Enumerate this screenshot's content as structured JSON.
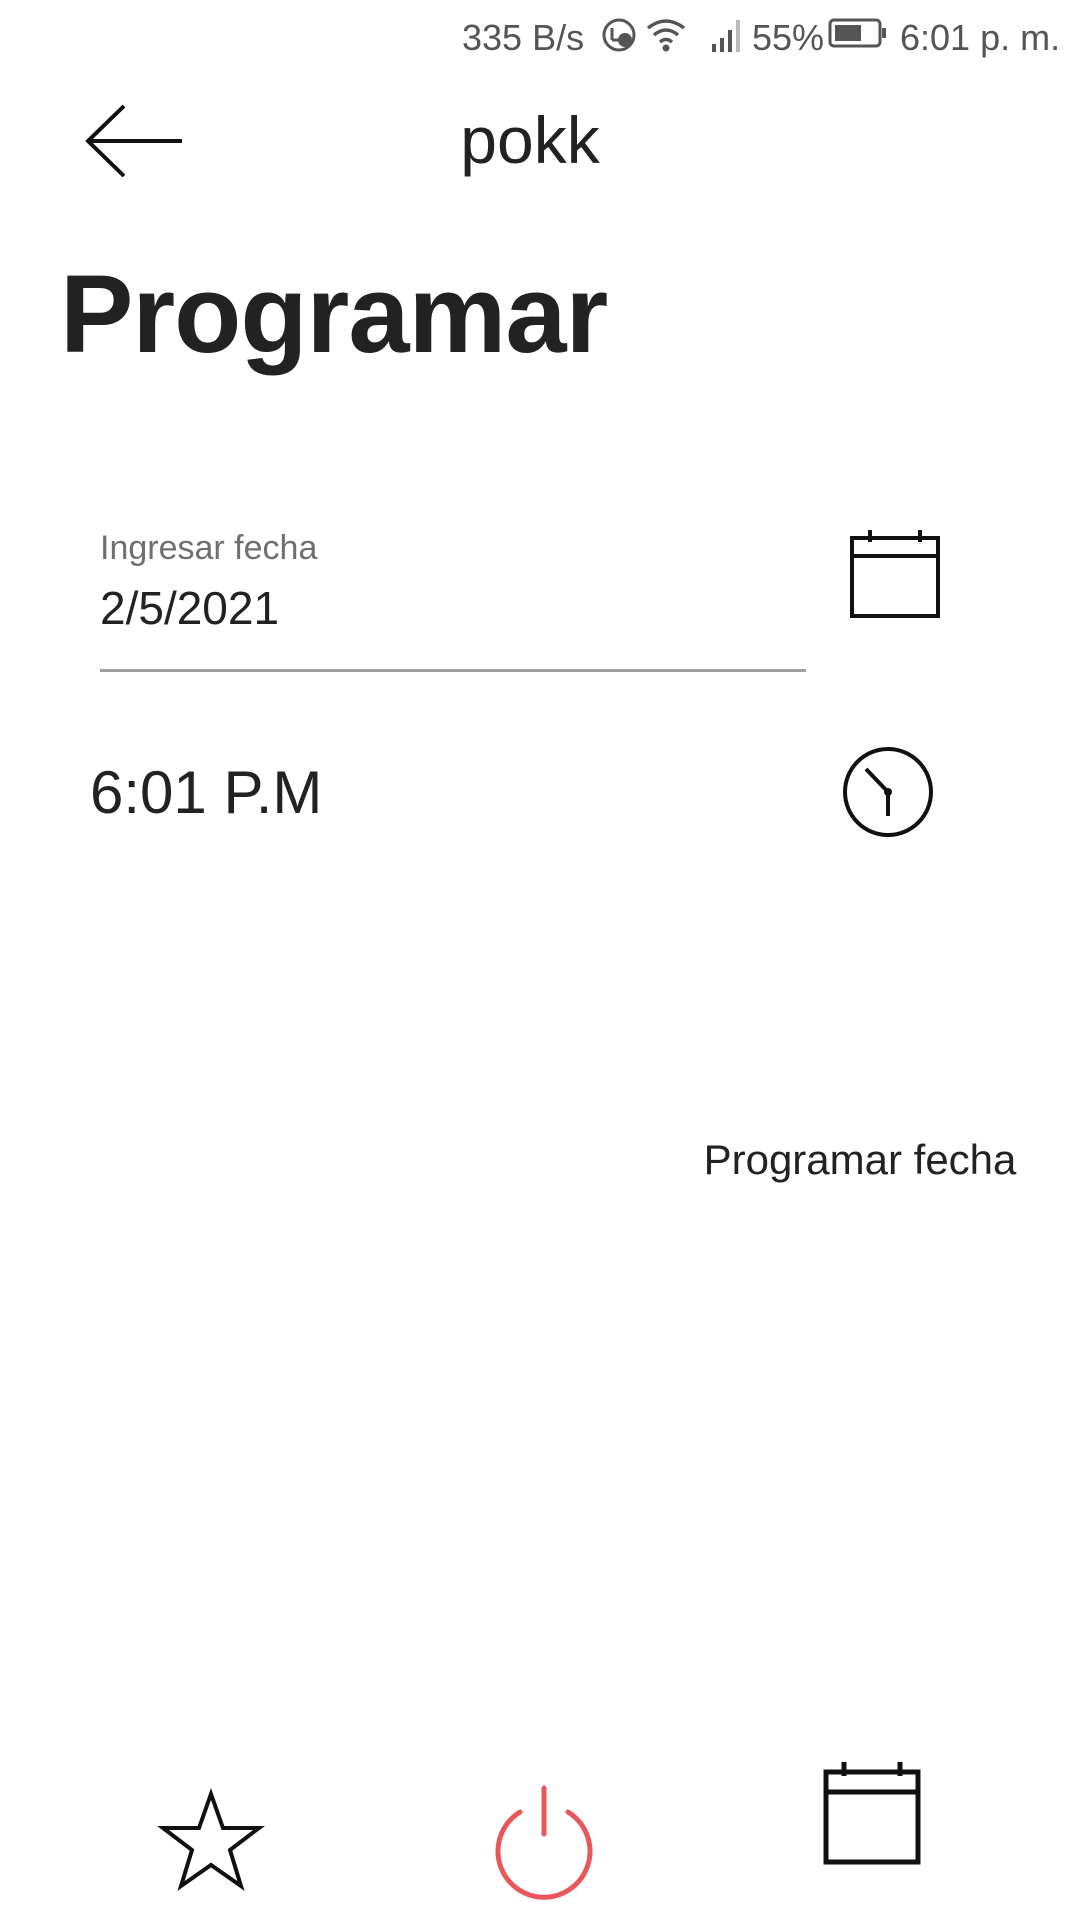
{
  "status_bar": {
    "network_speed": "335 B/s",
    "battery": "55%",
    "time": "6:01 p. m."
  },
  "app_bar": {
    "title": "pokk",
    "back_icon": "arrow-left-icon"
  },
  "page": {
    "title": "Programar"
  },
  "date_field": {
    "label": "Ingresar fecha",
    "value": "2/5/2021",
    "icon": "calendar-icon"
  },
  "time_field": {
    "value": "6:01 P.M",
    "icon": "clock-icon"
  },
  "schedule_button": {
    "label": "Programar fecha"
  },
  "bottom_nav": {
    "items": [
      {
        "icon": "star-icon"
      },
      {
        "icon": "power-icon",
        "color": "#e8575a"
      },
      {
        "icon": "calendar-icon"
      }
    ]
  },
  "colors": {
    "accent": "#e8575a",
    "text": "#222222",
    "muted": "#6f6f6f",
    "underline": "#9e9e9e"
  }
}
